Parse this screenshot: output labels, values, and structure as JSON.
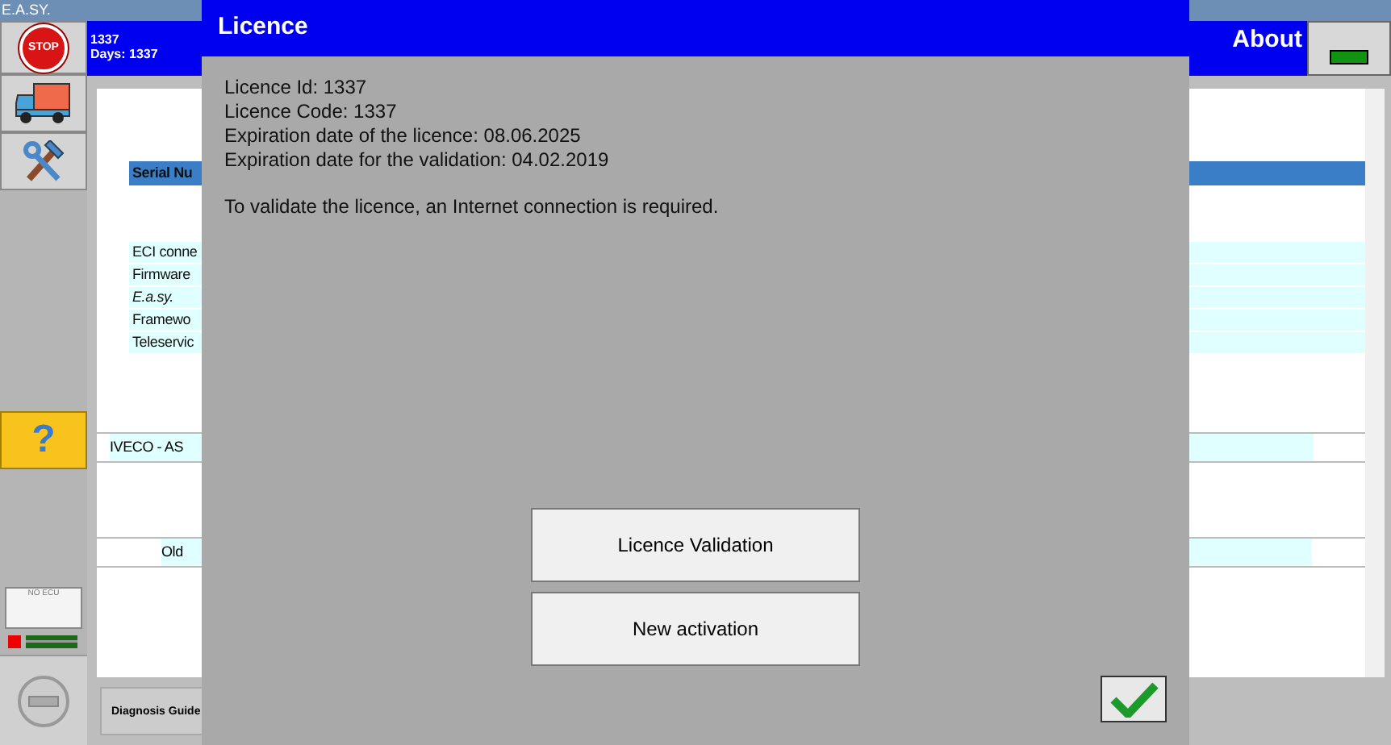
{
  "window": {
    "title": "E.A.SY."
  },
  "toolbar": {
    "stop_label": "STOP",
    "help_label": "?",
    "ecu_status": "NO ECU"
  },
  "header": {
    "vehicle_id": "1337",
    "days": "Days: 1337",
    "title": "About"
  },
  "background_table": {
    "header": "Serial Nu",
    "info_rows": [
      "ECI conne",
      "Firmware",
      "E.a.sy.",
      "Framewo",
      "Teleservic"
    ],
    "section_rows": [
      "IVECO - AS",
      "Old"
    ]
  },
  "bottom_bar": {
    "button": "Diagnosis Guide"
  },
  "dialog": {
    "title": "Licence",
    "lines": [
      "Licence Id: 1337",
      "Licence Code: 1337",
      "Expiration date of the licence: 08.06.2025",
      "Expiration date for the validation: 04.02.2019"
    ],
    "note": "To validate the licence, an Internet connection is required.",
    "buttons": [
      "Licence Validation",
      "New activation"
    ]
  }
}
